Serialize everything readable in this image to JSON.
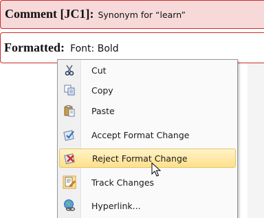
{
  "comment": {
    "label": "Comment [JC1]:",
    "text": "Synonym for “learn”"
  },
  "formatted": {
    "label": "Formatted:",
    "text": "Font: Bold"
  },
  "menu": {
    "items": [
      {
        "label": "Cut",
        "icon": "scissors-icon"
      },
      {
        "label": "Copy",
        "icon": "copy-icon"
      },
      {
        "label": "Paste",
        "icon": "paste-icon"
      },
      {
        "label": "Accept Format Change",
        "icon": "accept-change-icon"
      },
      {
        "label": "Reject Format Change",
        "icon": "reject-change-icon",
        "highlighted": true
      },
      {
        "label": "Track Changes",
        "icon": "track-changes-icon"
      },
      {
        "label": "Hyperlink...",
        "icon": "hyperlink-icon"
      }
    ]
  },
  "colors": {
    "balloon_border": "#cc2a2a",
    "comment_fill": "#f7d9d9",
    "highlight": "#ffe08a"
  }
}
